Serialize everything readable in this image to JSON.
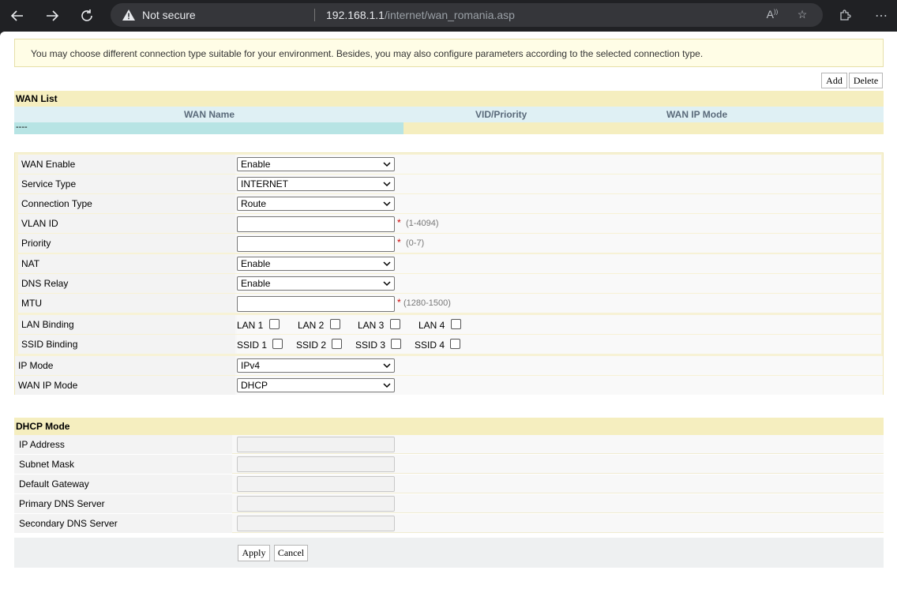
{
  "browser": {
    "not_secure": "Not secure",
    "url_host": "192.168.1.1",
    "url_path": "/internet/wan_romania.asp"
  },
  "notice": "You may choose different connection type suitable for your environment. Besides, you may also configure parameters according to the selected connection type.",
  "wan_list": {
    "add_label": "Add",
    "delete_label": "Delete",
    "title": "WAN List",
    "columns": [
      "WAN Name",
      "VID/Priority",
      "WAN IP Mode"
    ],
    "rows": [
      [
        "----",
        "",
        ""
      ]
    ]
  },
  "form": {
    "wan_enable": {
      "label": "WAN Enable",
      "value": "Enable"
    },
    "service_type": {
      "label": "Service Type",
      "value": "INTERNET"
    },
    "connection_type": {
      "label": "Connection Type",
      "value": "Route"
    },
    "vlan_id": {
      "label": "VLAN ID",
      "value": "",
      "required": "*",
      "hint": "(1-4094)"
    },
    "priority": {
      "label": "Priority",
      "value": "",
      "required": "*",
      "hint": "(0-7)"
    },
    "nat": {
      "label": "NAT",
      "value": "Enable"
    },
    "dns_relay": {
      "label": "DNS Relay",
      "value": "Enable"
    },
    "mtu": {
      "label": "MTU",
      "value": "",
      "required": "*",
      "hint": "(1280-1500)"
    },
    "lan_binding": {
      "label": "LAN Binding",
      "options": [
        "LAN 1",
        "LAN 2",
        "LAN 3",
        "LAN 4"
      ]
    },
    "ssid_binding": {
      "label": "SSID Binding",
      "options": [
        "SSID 1",
        "SSID 2",
        "SSID 3",
        "SSID 4"
      ]
    },
    "ip_mode": {
      "label": "IP Mode",
      "value": "IPv4"
    },
    "wan_ip_mode": {
      "label": "WAN IP Mode",
      "value": "DHCP"
    }
  },
  "dhcp": {
    "title": "DHCP Mode",
    "fields": [
      "IP Address",
      "Subnet Mask",
      "Default Gateway",
      "Primary DNS Server",
      "Secondary DNS Server"
    ]
  },
  "actions": {
    "apply": "Apply",
    "cancel": "Cancel"
  }
}
